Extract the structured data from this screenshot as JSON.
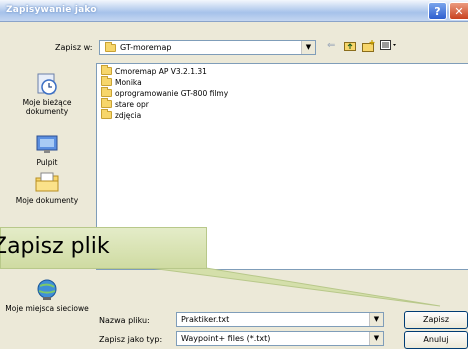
{
  "window": {
    "title": "Zapisywanie jako",
    "help_label": "?",
    "close_label": "✕"
  },
  "toolbar": {
    "save_in_label": "Zapisz w:",
    "save_in_underline": "Z",
    "save_in_value": "GT-moremap",
    "back_icon": "back-arrow",
    "up_icon": "up-folder",
    "new_folder_icon": "new-folder",
    "views_icon": "views-menu"
  },
  "places": [
    {
      "label": "Moje bieżące dokumenty",
      "icon": "recent-documents"
    },
    {
      "label": "Pulpit",
      "icon": "desktop"
    },
    {
      "label": "Moje dokumenty",
      "icon": "my-documents"
    },
    {
      "label": "Moje miejsca sieciowe",
      "icon": "network-places"
    }
  ],
  "files": [
    {
      "name": "Cmoremap AP V3.2.1.31"
    },
    {
      "name": "Monika"
    },
    {
      "name": "oprogramowanie GT-800 filmy"
    },
    {
      "name": "stare opr"
    },
    {
      "name": "zdjęcia"
    }
  ],
  "form": {
    "filename_label": "Nazwa pliku:",
    "filename_value": "Praktiker.txt",
    "filetype_label": "Zapisz jako typ:",
    "filetype_value": "Waypoint+ files (*.txt)",
    "save_button": "Zapisz",
    "cancel_button": "Anuluj"
  },
  "callout": {
    "text": "Zapisz plik"
  }
}
